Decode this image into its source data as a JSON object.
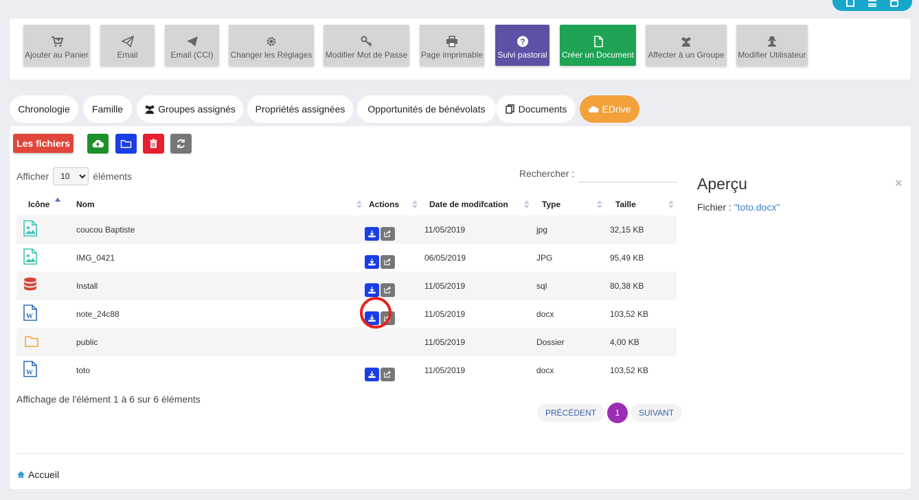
{
  "toolbar": {
    "buttons": [
      {
        "label": "Ajouter au Panier",
        "icon": "cart-plus-icon"
      },
      {
        "label": "Email",
        "icon": "paper-plane-outline-icon"
      },
      {
        "label": "Email (CCI)",
        "icon": "paper-plane-icon"
      },
      {
        "label": "Changer les Réglages",
        "icon": "gear-icon"
      },
      {
        "label": "Modifier Mot de Passe",
        "icon": "key-icon"
      },
      {
        "label": "Page imprimable",
        "icon": "print-icon"
      },
      {
        "label": "Suivi pastoral",
        "icon": "question-circle-icon"
      },
      {
        "label": "Créer un Document",
        "icon": "file-icon"
      },
      {
        "label": "Affecter à un Groupe",
        "icon": "users-icon"
      },
      {
        "label": "Modifier Utilisateur",
        "icon": "user-secret-icon"
      }
    ]
  },
  "tabs": [
    {
      "label": "Chronologie"
    },
    {
      "label": "Famille"
    },
    {
      "label": "Groupes assignés",
      "icon": "users-icon"
    },
    {
      "label": "Propriétés assignées"
    },
    {
      "label": "Opportunités de bénévolats"
    },
    {
      "label": "Documents",
      "icon": "copy-icon"
    },
    {
      "label": "EDrive",
      "icon": "cloud-icon",
      "active": true
    }
  ],
  "files_panel": {
    "title": "Les fichiers",
    "length_prefix": "Afficher",
    "length_value": "10",
    "length_suffix": "éléments",
    "search_label": "Rechercher :",
    "columns": [
      "Icône",
      "Nom",
      "Actions",
      "Date de modifcation",
      "Type",
      "Taille"
    ],
    "rows": [
      {
        "icon": "image-file-icon",
        "name": "coucou Baptiste",
        "date": "11/05/2019",
        "type": "jpg",
        "size": "32,15 KB",
        "actions": true
      },
      {
        "icon": "image-file-icon",
        "name": "IMG_0421",
        "date": "06/05/2019",
        "type": "JPG",
        "size": "95,49 KB",
        "actions": true
      },
      {
        "icon": "database-icon",
        "name": "Install",
        "date": "11/05/2019",
        "type": "sql",
        "size": "80,38 KB",
        "actions": true
      },
      {
        "icon": "word-file-icon",
        "name": "note_24c88",
        "date": "11/05/2019",
        "type": "docx",
        "size": "103,52 KB",
        "actions": true
      },
      {
        "icon": "folder-icon",
        "name": "public",
        "date": "11/05/2019",
        "type": "Dossier",
        "size": "4,00 KB",
        "actions": false
      },
      {
        "icon": "word-file-icon",
        "name": "toto",
        "date": "11/05/2019",
        "type": "docx",
        "size": "103,52 KB",
        "actions": true
      }
    ],
    "info": "Affichage de l'élément 1 à 6 sur 6 éléments",
    "pagination": {
      "prev": "PRÉCÉDENT",
      "current": "1",
      "next": "SUIVANT"
    }
  },
  "preview": {
    "title": "Aperçu",
    "close": "×",
    "file_label": "Fichier : ",
    "file_name": "\"toto.docx\""
  },
  "footer": {
    "home_label": "Accueil"
  },
  "colors": {
    "accent_orange": "#f3a13b",
    "purple": "#5b52a6",
    "green": "#1fa455",
    "red": "#e0463b",
    "blue": "#1a3ee6",
    "pager_purple": "#9b2eb3"
  }
}
